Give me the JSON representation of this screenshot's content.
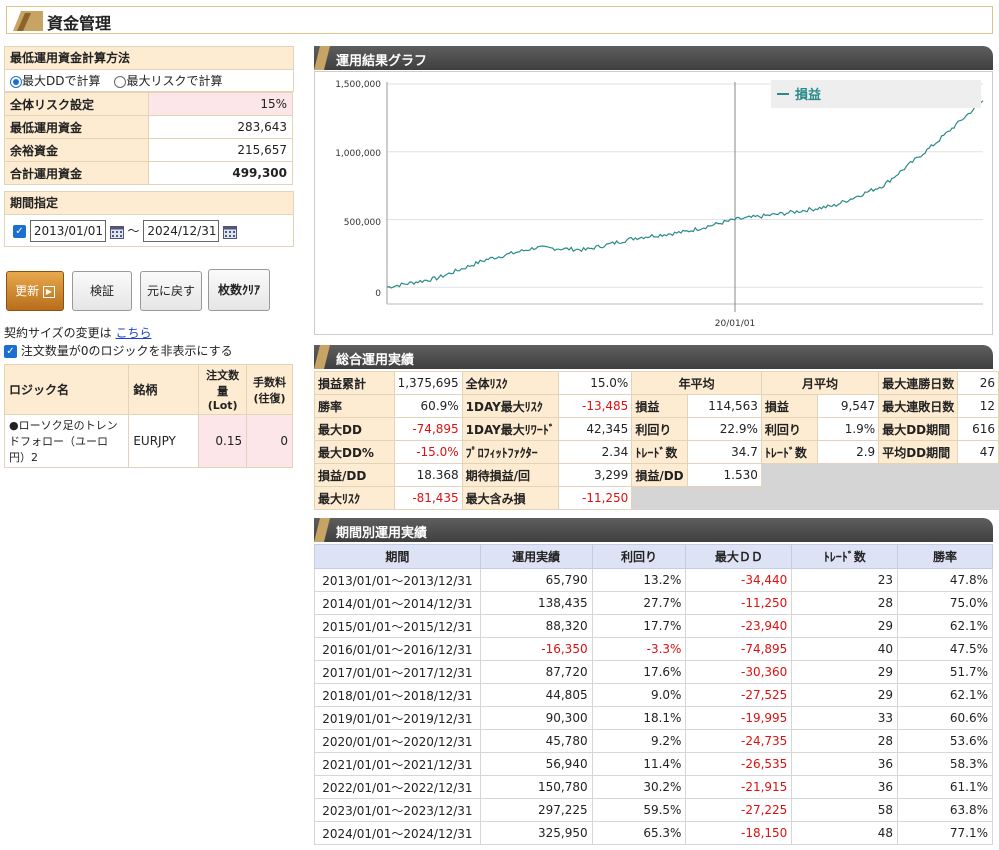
{
  "header": {
    "title": "資金管理"
  },
  "left": {
    "calc_method_title": "最低運用資金計算方法",
    "radio_dd": "最大DDで計算",
    "radio_risk": "最大リスクで計算",
    "rows": [
      {
        "label": "全体リスク設定",
        "value": "15%"
      },
      {
        "label": "最低運用資金",
        "value": "283,643"
      },
      {
        "label": "余裕資金",
        "value": "215,657"
      },
      {
        "label": "合計運用資金",
        "value": "499,300"
      }
    ],
    "period_title": "期間指定",
    "date_from": "2013/01/01",
    "tilde": "～",
    "date_to": "2024/12/31",
    "buttons": {
      "update": "更新",
      "verify": "検証",
      "reset": "元に戻す",
      "clear": "枚数ｸﾘｱ"
    },
    "contract_note": "契約サイズの変更は",
    "contract_link": "こちら",
    "hide_zero_note": "注文数量が0のロジックを非表示にする",
    "logic_headers": {
      "name": "ロジック名",
      "symbol": "銘柄",
      "qty": "注文数量(Lot)",
      "fee": "手数料(往復)"
    },
    "logic_row": {
      "name": "●ローソク足のトレンドフォロー（ユーロ円）2",
      "symbol": "EURJPY",
      "qty": "0.15",
      "fee": "0"
    }
  },
  "graph": {
    "title": "運用結果グラフ",
    "legend": "損益",
    "x_tick": "20/01/01",
    "y_ticks": [
      "1,500,000",
      "1,000,000",
      "500,000",
      "0"
    ]
  },
  "chart_data": {
    "type": "line",
    "series": [
      {
        "name": "損益",
        "x": [
          "2013/01",
          "2014/01",
          "2015/01",
          "2016/01",
          "2017/01",
          "2018/01",
          "2019/01",
          "2020/01",
          "2021/01",
          "2022/01",
          "2023/01",
          "2024/01",
          "2024/12"
        ],
        "values": [
          0,
          65790,
          204225,
          292545,
          276195,
          363915,
          408720,
          499020,
          544800,
          601740,
          752470,
          1049695,
          1375645
        ]
      }
    ],
    "ylim": [
      -50000,
      1500000
    ],
    "yticks": [
      0,
      500000,
      1000000,
      1500000
    ],
    "line_color": "#2a8a8a"
  },
  "summary": {
    "title": "総合運用実績",
    "col1": [
      {
        "label": "損益累計",
        "value": "1,375,695"
      },
      {
        "label": "勝率",
        "value": "60.9%"
      },
      {
        "label": "最大DD",
        "value": "-74,895"
      },
      {
        "label": "最大DD%",
        "value": "-15.0%"
      },
      {
        "label": "損益/DD",
        "value": "18.368"
      },
      {
        "label": "最大ﾘｽｸ",
        "value": "-81,435"
      }
    ],
    "col2": [
      {
        "label": "全体ﾘｽｸ",
        "value": "15.0%"
      },
      {
        "label": "1DAY最大ﾘｽｸ",
        "value": "-13,485"
      },
      {
        "label": "1DAY最大ﾘﾜｰﾄﾞ",
        "value": "42,345"
      },
      {
        "label": "ﾌﾟﾛﾌｨｯﾄﾌｧｸﾀｰ",
        "value": "2.34"
      },
      {
        "label": "期待損益/回",
        "value": "3,299"
      },
      {
        "label": "最大含み損",
        "value": "-11,250"
      }
    ],
    "year_avg_title": "年平均",
    "year_avg": [
      {
        "label": "損益",
        "value": "114,563"
      },
      {
        "label": "利回り",
        "value": "22.9%"
      },
      {
        "label": "ﾄﾚｰﾄﾞ数",
        "value": "34.7"
      },
      {
        "label": "損益/DD",
        "value": "1.530"
      }
    ],
    "month_avg_title": "月平均",
    "month_avg": [
      {
        "label": "損益",
        "value": "9,547"
      },
      {
        "label": "利回り",
        "value": "1.9%"
      },
      {
        "label": "ﾄﾚｰﾄﾞ数",
        "value": "2.9"
      }
    ],
    "col5": [
      {
        "label": "最大連勝日数",
        "value": "26"
      },
      {
        "label": "最大連敗日数",
        "value": "12"
      },
      {
        "label": "最大DD期間",
        "value": "616"
      },
      {
        "label": "平均DD期間",
        "value": "47"
      }
    ]
  },
  "period": {
    "title": "期間別運用実績",
    "headers": [
      "期間",
      "運用実績",
      "利回り",
      "最大ＤＤ",
      "ﾄﾚｰﾄﾞ数",
      "勝率"
    ],
    "rows": [
      [
        "2013/01/01～2013/12/31",
        "65,790",
        "13.2%",
        "-34,440",
        "23",
        "47.8%"
      ],
      [
        "2014/01/01～2014/12/31",
        "138,435",
        "27.7%",
        "-11,250",
        "28",
        "75.0%"
      ],
      [
        "2015/01/01～2015/12/31",
        "88,320",
        "17.7%",
        "-23,940",
        "29",
        "62.1%"
      ],
      [
        "2016/01/01～2016/12/31",
        "-16,350",
        "-3.3%",
        "-74,895",
        "40",
        "47.5%"
      ],
      [
        "2017/01/01～2017/12/31",
        "87,720",
        "17.6%",
        "-30,360",
        "29",
        "51.7%"
      ],
      [
        "2018/01/01～2018/12/31",
        "44,805",
        "9.0%",
        "-27,525",
        "29",
        "62.1%"
      ],
      [
        "2019/01/01～2019/12/31",
        "90,300",
        "18.1%",
        "-19,995",
        "33",
        "60.6%"
      ],
      [
        "2020/01/01～2020/12/31",
        "45,780",
        "9.2%",
        "-24,735",
        "28",
        "53.6%"
      ],
      [
        "2021/01/01～2021/12/31",
        "56,940",
        "11.4%",
        "-26,535",
        "36",
        "58.3%"
      ],
      [
        "2022/01/01～2022/12/31",
        "150,780",
        "30.2%",
        "-21,915",
        "36",
        "61.1%"
      ],
      [
        "2023/01/01～2023/12/31",
        "297,225",
        "59.5%",
        "-27,225",
        "58",
        "63.8%"
      ],
      [
        "2024/01/01～2024/12/31",
        "325,950",
        "65.3%",
        "-18,150",
        "48",
        "77.1%"
      ]
    ]
  }
}
